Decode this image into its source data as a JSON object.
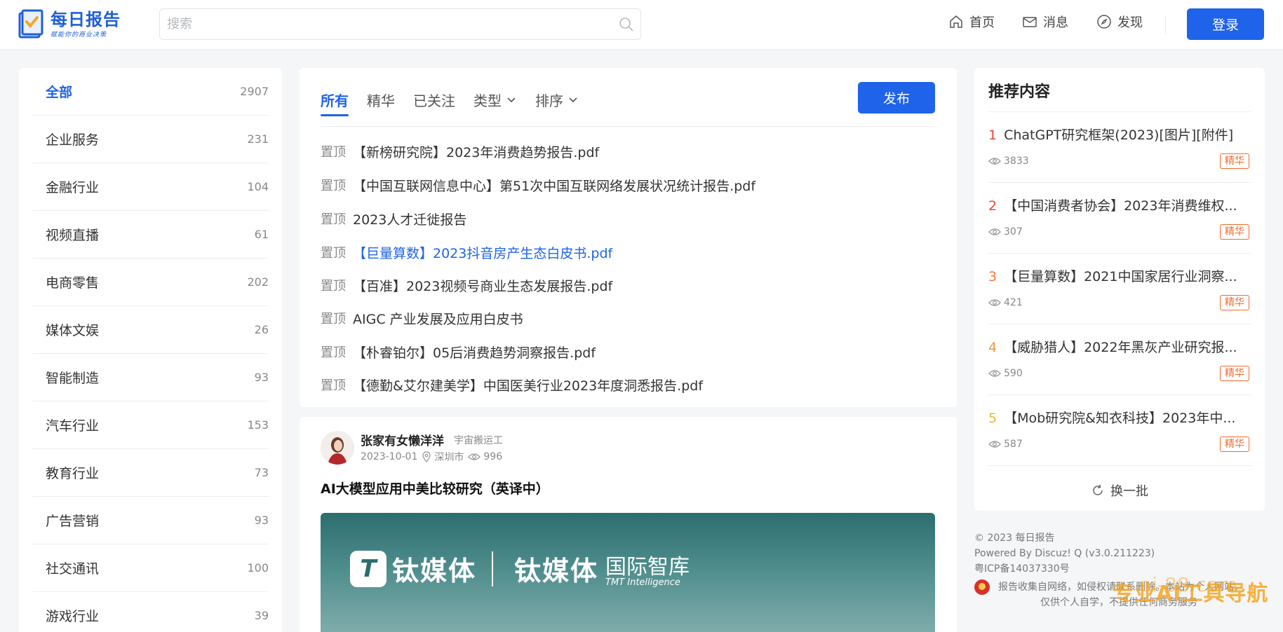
{
  "header": {
    "logo_title": "每日报告",
    "logo_sub": "赋能你的商业决策",
    "search_placeholder": "搜索",
    "nav": [
      {
        "label": "首页",
        "icon": "home-icon"
      },
      {
        "label": "消息",
        "icon": "mail-icon"
      },
      {
        "label": "发现",
        "icon": "compass-icon"
      }
    ],
    "login_label": "登录"
  },
  "sidebar": {
    "categories": [
      {
        "name": "全部",
        "count": "2907",
        "active": true
      },
      {
        "name": "企业服务",
        "count": "231"
      },
      {
        "name": "金融行业",
        "count": "104"
      },
      {
        "name": "视频直播",
        "count": "61"
      },
      {
        "name": "电商零售",
        "count": "202"
      },
      {
        "name": "媒体文娱",
        "count": "26"
      },
      {
        "name": "智能制造",
        "count": "93"
      },
      {
        "name": "汽车行业",
        "count": "153"
      },
      {
        "name": "教育行业",
        "count": "73"
      },
      {
        "name": "广告营销",
        "count": "93"
      },
      {
        "name": "社交通讯",
        "count": "100"
      },
      {
        "name": "游戏行业",
        "count": "39"
      }
    ]
  },
  "main": {
    "tabs": [
      {
        "label": "所有",
        "active": true
      },
      {
        "label": "精华"
      },
      {
        "label": "已关注"
      },
      {
        "label": "类型",
        "dropdown": true
      },
      {
        "label": "排序",
        "dropdown": true
      }
    ],
    "publish_label": "发布",
    "pin_label": "置顶",
    "posts": [
      {
        "title": "【新榜研究院】2023年消费趋势报告.pdf"
      },
      {
        "title": "【中国互联网信息中心】第51次中国互联网络发展状况统计报告.pdf"
      },
      {
        "title": "2023人才迁徙报告"
      },
      {
        "title": "【巨量算数】2023抖音房产生态白皮书.pdf",
        "highlight": true
      },
      {
        "title": "【百准】2023视频号商业生态发展报告.pdf"
      },
      {
        "title": "AIGC 产业发展及应用白皮书"
      },
      {
        "title": "【朴睿铂尔】05后消费趋势洞察报告.pdf"
      },
      {
        "title": "【德勤&艾尔建美学】中国医美行业2023年度洞悉报告.pdf"
      }
    ]
  },
  "feed": {
    "author": "张家有女懒洋洋",
    "author_tag": "宇宙搬运工",
    "date": "2023-10-01",
    "location": "深圳市",
    "views": "996",
    "title": "AI大模型应用中美比较研究（英译中）",
    "banner": {
      "mark": "T",
      "name_left": "钛媒体",
      "name_right": "钛媒体",
      "intl": "国际智库",
      "tmt": "TMT Intelligence"
    }
  },
  "recommend": {
    "title": "推荐内容",
    "badge_label": "精华",
    "items": [
      {
        "rank": "1",
        "title": "ChatGPT研究框架(2023)[图片][附件]",
        "views": "3833",
        "rank_color": "#e8453c"
      },
      {
        "rank": "2",
        "title": "【中国消费者协会】2023年消费维权...",
        "views": "307",
        "rank_color": "#e8453c"
      },
      {
        "rank": "3",
        "title": "【巨量算数】2021中国家居行业洞察...",
        "views": "421",
        "rank_color": "#f47b3a"
      },
      {
        "rank": "4",
        "title": "【威胁猎人】2022年黑灰产业研究报...",
        "views": "590",
        "rank_color": "#f4963a"
      },
      {
        "rank": "5",
        "title": "【Mob研究院&知衣科技】2023年中...",
        "views": "587",
        "rank_color": "#f5b23a"
      }
    ],
    "refresh_label": "换一批"
  },
  "footer": {
    "copyright": "© 2023 每日报告",
    "powered": "Powered By Discuz! Q (v3.0.211223)",
    "icp": "粤ICP备14037330号",
    "notice_line1": "报告收集自网络，如侵权请联系删除。本站为个人网站，",
    "notice_line2": "仅供个人自学，不提供任何商务服务"
  },
  "watermark": {
    "site": "ai-88.com",
    "slogan": "专业AI工具导航"
  },
  "colors": {
    "accent": "#1e63e9",
    "badge": "#f46a2a",
    "page_bg": "#f5f6f8"
  }
}
